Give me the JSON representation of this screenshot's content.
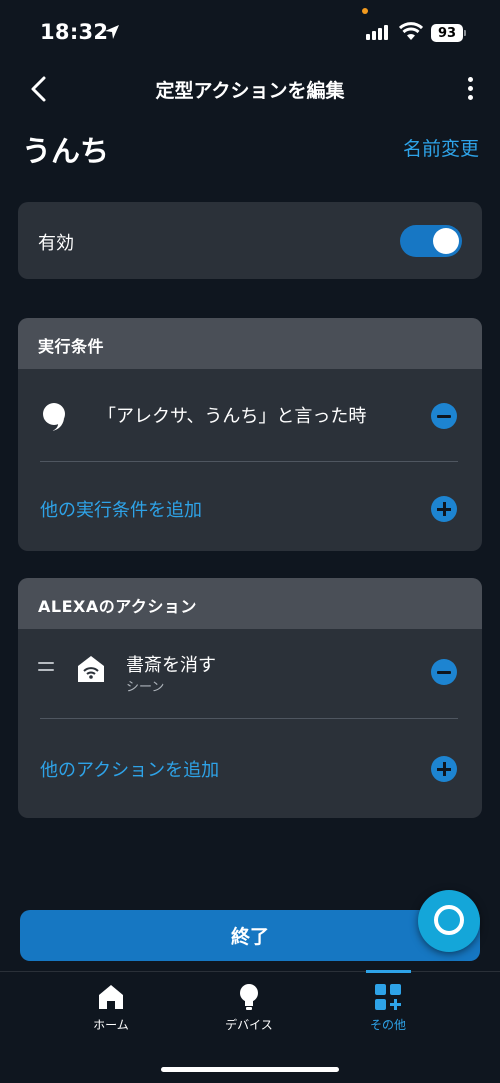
{
  "status_bar": {
    "time": "18:32",
    "battery": "93"
  },
  "header": {
    "title": "定型アクションを編集"
  },
  "routine": {
    "name": "うんち",
    "rename_label": "名前変更"
  },
  "toggle_card": {
    "label": "有効",
    "enabled": true
  },
  "conditions": {
    "title": "実行条件",
    "items": [
      {
        "text": "「アレクサ、うんち」と言った時",
        "icon": "speech-bubble-icon"
      }
    ],
    "add_label": "他の実行条件を追加"
  },
  "actions": {
    "title": "ALEXAのアクション",
    "items": [
      {
        "title": "書斎を消す",
        "subtitle": "シーン",
        "icon": "scene-home-icon"
      }
    ],
    "add_label": "他のアクションを追加"
  },
  "finish_label": "終了",
  "nav": {
    "items": [
      {
        "label": "ホーム",
        "icon": "home-icon"
      },
      {
        "label": "デバイス",
        "icon": "bulb-icon"
      },
      {
        "label": "その他",
        "icon": "more-grid-icon",
        "active": true
      }
    ]
  },
  "colors": {
    "accent": "#2ea3e8",
    "button": "#1677c2",
    "card": "#2b3139",
    "background": "#0f161f"
  }
}
